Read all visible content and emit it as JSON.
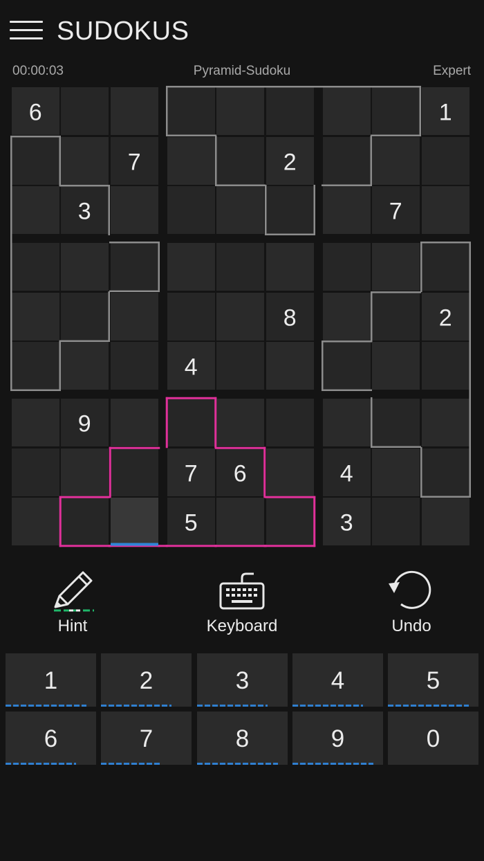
{
  "header": {
    "title": "SUDOKUS",
    "menu_icon": "hamburger-menu-icon"
  },
  "status": {
    "timer": "00:00:03",
    "puzzle_name": "Pyramid-Sudoku",
    "difficulty": "Expert"
  },
  "board": {
    "rows": [
      [
        "6",
        "",
        "",
        "",
        "",
        "",
        "",
        "",
        "1"
      ],
      [
        "",
        "",
        "7",
        "",
        "",
        "2",
        "",
        "",
        ""
      ],
      [
        "",
        "3",
        "",
        "",
        "",
        "",
        "",
        "7",
        ""
      ],
      [
        "",
        "",
        "",
        "",
        "",
        "",
        "",
        "",
        ""
      ],
      [
        "",
        "",
        "",
        "",
        "",
        "8",
        "",
        "",
        "2"
      ],
      [
        "",
        "",
        "",
        "4",
        "",
        "",
        "",
        "",
        ""
      ],
      [
        "",
        "9",
        "",
        "",
        "",
        "",
        "",
        "",
        ""
      ],
      [
        "",
        "",
        "",
        "7",
        "6",
        "",
        "4",
        "",
        ""
      ],
      [
        "",
        "",
        "",
        "5",
        "",
        "",
        "3",
        "",
        ""
      ]
    ],
    "selected_cell": {
      "row": 9,
      "col": 3
    },
    "pyramid_regions": {
      "top": [
        [
          1,
          4
        ],
        [
          1,
          5
        ],
        [
          1,
          6
        ],
        [
          1,
          7
        ],
        [
          1,
          8
        ],
        [
          2,
          5
        ],
        [
          2,
          6
        ],
        [
          2,
          7
        ],
        [
          3,
          6
        ]
      ],
      "left": [
        [
          2,
          1
        ],
        [
          3,
          1
        ],
        [
          3,
          2
        ],
        [
          4,
          1
        ],
        [
          4,
          2
        ],
        [
          4,
          3
        ],
        [
          5,
          1
        ],
        [
          5,
          2
        ],
        [
          6,
          1
        ]
      ],
      "right": [
        [
          4,
          9
        ],
        [
          5,
          8
        ],
        [
          5,
          9
        ],
        [
          6,
          7
        ],
        [
          6,
          8
        ],
        [
          6,
          9
        ],
        [
          7,
          8
        ],
        [
          7,
          9
        ],
        [
          8,
          9
        ]
      ],
      "bottom": [
        [
          7,
          4
        ],
        [
          8,
          3
        ],
        [
          8,
          4
        ],
        [
          8,
          5
        ],
        [
          9,
          2
        ],
        [
          9,
          3
        ],
        [
          9,
          4
        ],
        [
          9,
          5
        ],
        [
          9,
          6
        ]
      ]
    },
    "highlighted_region": "bottom",
    "colors": {
      "region_outline": "#8c8c8c",
      "highlight_outline": "#e0309a",
      "selection_bar": "#2f86d8"
    }
  },
  "tools": [
    {
      "label": "Hint",
      "icon": "pencil-icon"
    },
    {
      "label": "Keyboard",
      "icon": "keyboard-icon"
    },
    {
      "label": "Undo",
      "icon": "undo-icon"
    }
  ],
  "keypad": {
    "keys": [
      {
        "label": "1",
        "remaining_fraction": 0.89
      },
      {
        "label": "2",
        "remaining_fraction": 0.78
      },
      {
        "label": "3",
        "remaining_fraction": 0.78
      },
      {
        "label": "4",
        "remaining_fraction": 0.78
      },
      {
        "label": "5",
        "remaining_fraction": 0.89
      },
      {
        "label": "6",
        "remaining_fraction": 0.78
      },
      {
        "label": "7",
        "remaining_fraction": 0.67
      },
      {
        "label": "8",
        "remaining_fraction": 0.89
      },
      {
        "label": "9",
        "remaining_fraction": 0.89
      },
      {
        "label": "0",
        "remaining_fraction": 0
      }
    ],
    "accent_color": "#2f7fd0"
  }
}
